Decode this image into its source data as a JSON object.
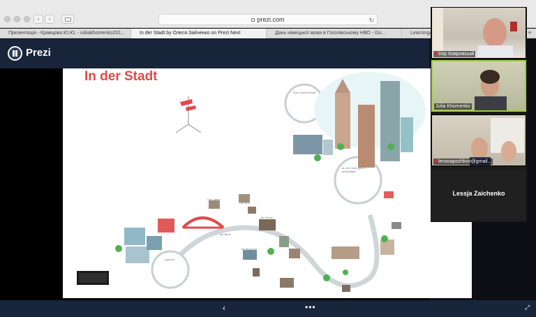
{
  "browser": {
    "url": "prezi.com",
    "tabs": [
      {
        "label": "Презентація - Кравцова Ю.Ю. - iuliiakhomenko201..."
      },
      {
        "label": "In der Stadt by Олеся Зайченко on Prezi Next"
      },
      {
        "label": "Дань німецької мови в Гоголівському НВО - Go..."
      },
      {
        "label": "LearningAp"
      }
    ],
    "new_tab": "+"
  },
  "prezi": {
    "logo_text": "Prezi",
    "title": "In der Stadt",
    "bubble_top_title": "Das Kaufen etwas",
    "bubble_mid_title": "Ja, die Leute gibt in vorschlägen",
    "bubble_low_title": "Agenda",
    "labels": [
      "Der Laden",
      "die Bank",
      "Der Bus",
      "die Kirche",
      "der Brunnen"
    ],
    "prev_arrow": "‹",
    "more": "•••",
    "fullscreen": "⤢"
  },
  "participants": [
    {
      "name": "Ігор Ковровськй"
    },
    {
      "name": "Julia Khomenko"
    },
    {
      "name": "lenasapozhkov@gmail..."
    },
    {
      "name": "Lessja Zaichenko"
    }
  ],
  "colors": {
    "prezi_header": "#17243a",
    "title_red": "#e04a4a",
    "active_speaker": "#9bcf3d"
  }
}
